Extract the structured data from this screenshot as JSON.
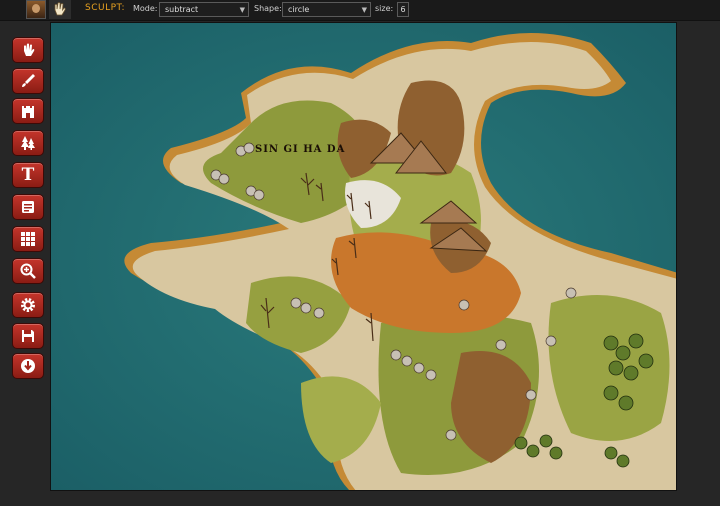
{
  "toolbar": {
    "mode_label": "SCULPT:",
    "mode_field_label": "Mode:",
    "mode_value": "subtract",
    "shape_field_label": "Shape:",
    "shape_value": "circle",
    "size_field_label": "size:",
    "size_value": "6"
  },
  "sidebar": {
    "tools": [
      {
        "name": "sculpt-tool",
        "icon": "hand-icon"
      },
      {
        "name": "paint-tool",
        "icon": "brush-icon"
      },
      {
        "name": "building-tool",
        "icon": "castle-icon"
      },
      {
        "name": "tree-tool",
        "icon": "tree-icon"
      },
      {
        "name": "text-tool",
        "icon": "text-icon"
      },
      {
        "name": "notes-tool",
        "icon": "notes-icon"
      },
      {
        "name": "grid-tool",
        "icon": "grid-icon"
      },
      {
        "name": "zoom-tool",
        "icon": "magnifier-icon"
      },
      {
        "name": "settings-tool",
        "icon": "gear-icon"
      },
      {
        "name": "save-tool",
        "icon": "floppy-icon"
      },
      {
        "name": "export-tool",
        "icon": "download-icon"
      }
    ]
  },
  "map": {
    "place_label": "SIN GI HA DA",
    "colors": {
      "water": "#206b70",
      "sand": "#d9c9a3",
      "grass": "#8c9a3a",
      "dirt": "#9a6a35",
      "orange": "#c9772c"
    }
  }
}
